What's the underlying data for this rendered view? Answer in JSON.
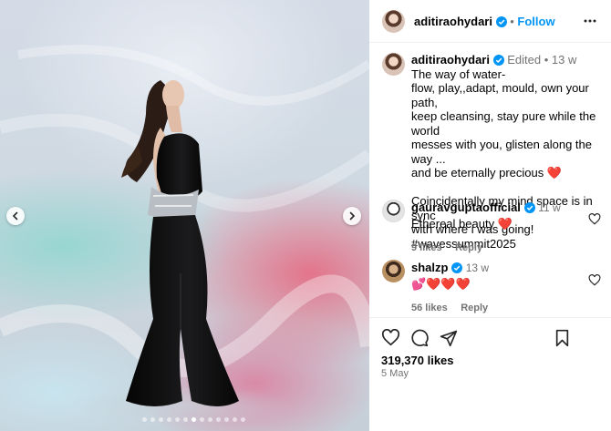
{
  "post": {
    "dots_total": 13,
    "dot_active_index": 6
  },
  "header": {
    "username": "aditiraohydari",
    "separator": "•",
    "follow_label": "Follow",
    "more_icon": "more-horizontal-icon"
  },
  "caption": {
    "username": "aditiraohydari",
    "edited": "Edited",
    "separator": "•",
    "time": "13 w",
    "lines": [
      "The way of water-",
      "flow, play,,adapt, mould, own your path,",
      "keep cleansing, stay pure while the world",
      "messes with you, glisten along the way ...",
      "and be eternally precious ❤️",
      "",
      "Coincidentally my mind space is in sync",
      "with where i was going!"
    ],
    "hashtag": "#wavessummit2025"
  },
  "comments": [
    {
      "username": "gauravguptaofficial",
      "time": "11 w",
      "text": "Ethereal beauty ❤️",
      "likes": "9 likes",
      "reply": "Reply"
    },
    {
      "username": "shalzp",
      "time": "13 w",
      "text": "💕❤️❤️❤️",
      "likes": "56 likes",
      "reply": "Reply"
    }
  ],
  "actions": {
    "likes": "319,370 likes",
    "date": "5 May"
  },
  "colors": {
    "accent": "#0095f6",
    "heart": "#ed4956",
    "muted": "#737373"
  }
}
